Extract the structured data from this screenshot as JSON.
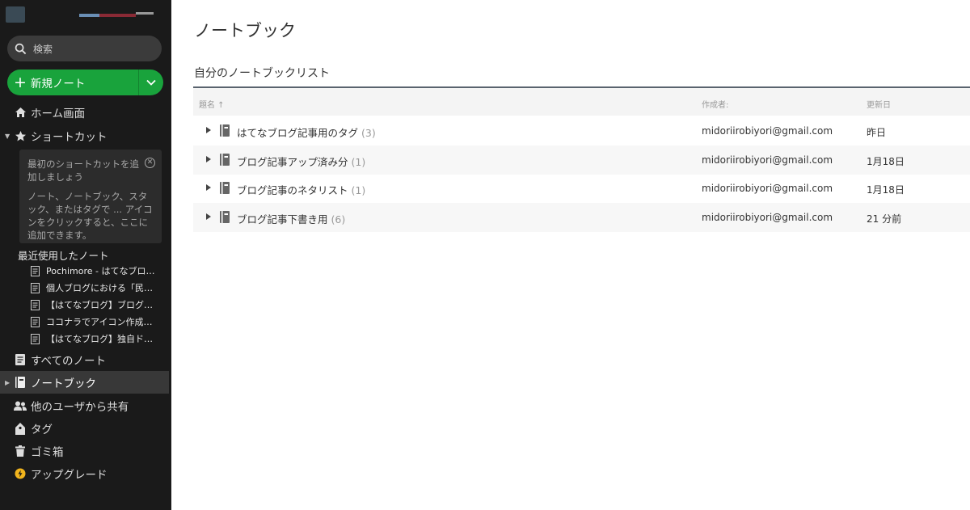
{
  "sidebar": {
    "search_placeholder": "検索",
    "new_note_label": "新規ノート",
    "nav": {
      "home": "ホーム画面",
      "shortcuts": "ショートカット",
      "all_notes": "すべてのノート",
      "notebooks": "ノートブック",
      "shared": "他のユーザから共有",
      "tags": "タグ",
      "trash": "ゴミ箱",
      "upgrade": "アップグレード"
    },
    "shortcut_hint": {
      "line1": "最初のショートカットを追加しましょう",
      "line2": "ノート、ノートブック、スタック、またはタグで ... アイコンをクリックすると、ここに追加できます。"
    },
    "recent_title": "最近使用したノート",
    "recent_notes": [
      "Pochimore - はてなブログだ…",
      "個人ブログにおける「民…",
      "【はてなブログ】ブログ…",
      "ココナラでアイコン作成…",
      "【はてなブログ】独自ド…"
    ]
  },
  "main": {
    "title": "ノートブック",
    "section_title": "自分のノートブックリスト",
    "columns": {
      "name": "題名 ↑",
      "owner": "作成者:",
      "updated": "更新日"
    },
    "notebooks": [
      {
        "name": "はてなブログ記事用のタグ",
        "count": "(3)",
        "owner": "midoriirobiyori@gmail.com",
        "updated": "昨日"
      },
      {
        "name": "ブログ記事アップ済み分",
        "count": "(1)",
        "owner": "midoriirobiyori@gmail.com",
        "updated": "1月18日"
      },
      {
        "name": "ブログ記事のネタリスト",
        "count": "(1)",
        "owner": "midoriirobiyori@gmail.com",
        "updated": "1月18日"
      },
      {
        "name": "ブログ記事下書き用",
        "count": "(6)",
        "owner": "midoriirobiyori@gmail.com",
        "updated": "21 分前"
      }
    ]
  },
  "colors": {
    "sidebar_bg": "#1a1a1a",
    "accent_green": "#19a33c",
    "active_item_bg": "#383838",
    "upgrade_badge": "#f2b51d"
  }
}
